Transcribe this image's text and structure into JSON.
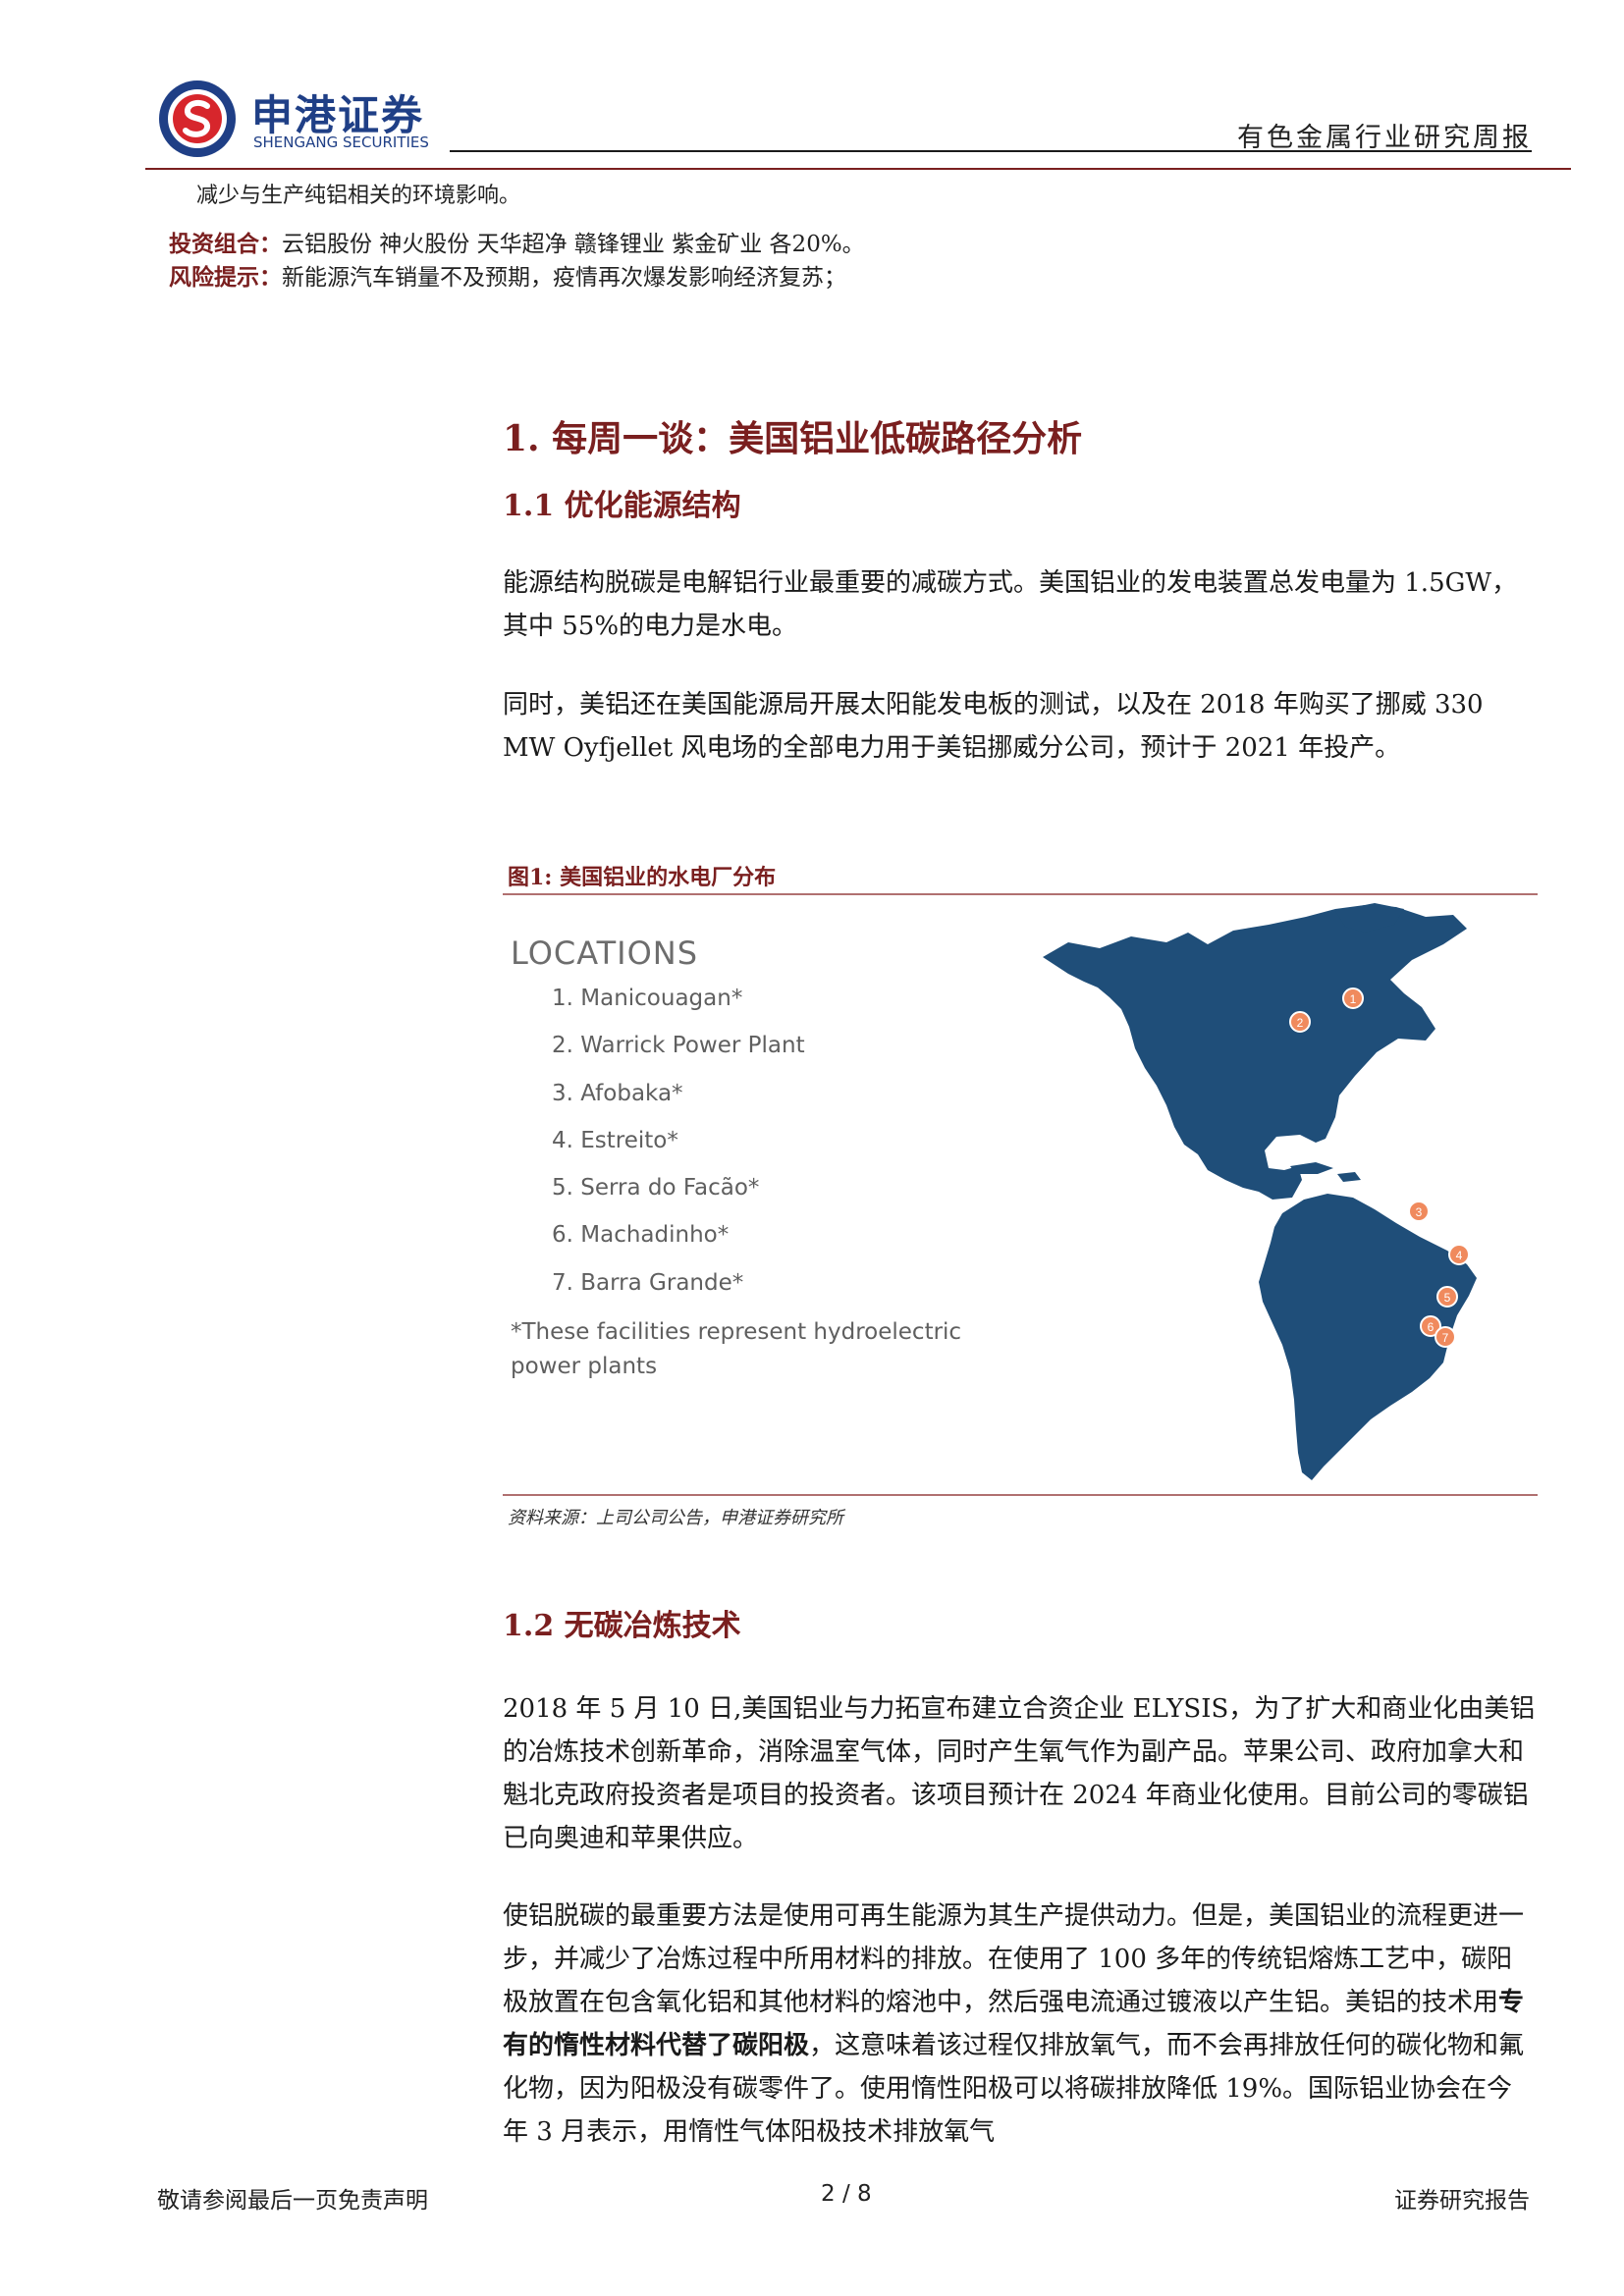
{
  "header": {
    "brand_cn": "申港证券",
    "brand_en": "SHENGANG SECURITIES",
    "report_type": "有色金属行业研究周报",
    "colors": {
      "brand_blue": "#1f3f86",
      "brand_red": "#d7262c",
      "accent": "#7a1f1f"
    }
  },
  "summary": {
    "carry_over": "减少与生产纯铝相关的环境影响。",
    "portfolio_label": "投资组合：",
    "portfolio_text": "云铝股份 神火股份 天华超净 赣锋锂业 紫金矿业 各20%。",
    "risk_label": "风险提示：",
    "risk_text": "新能源汽车销量不及预期，疫情再次爆发影响经济复苏；"
  },
  "section1": {
    "title": "1. 每周一谈：美国铝业低碳路径分析",
    "sub1_title": "1.1 优化能源结构",
    "para1": "能源结构脱碳是电解铝行业最重要的减碳方式。美国铝业的发电装置总发电量为 1.5GW，其中 55%的电力是水电。",
    "para2": "同时，美铝还在美国能源局开展太阳能发电板的测试，以及在 2018 年购买了挪威 330 MW Oyfjellet 风电场的全部电力用于美铝挪威分公司，预计于 2021 年投产。",
    "sub2_title": "1.2 无碳冶炼技术",
    "para3": "2018 年 5 月 10 日,美国铝业与力拓宣布建立合资企业 ELYSIS，为了扩大和商业化由美铝的冶炼技术创新革命，消除温室气体，同时产生氧气作为副产品。苹果公司、政府加拿大和魁北克政府投资者是项目的投资者。该项目预计在 2024 年商业化使用。目前公司的零碳铝已向奥迪和苹果供应。",
    "para4_a": "使铝脱碳的最重要方法是使用可再生能源为其生产提供动力。但是，美国铝业的流程更进一步，并减少了冶炼过程中所用材料的排放。在使用了 100 多年的传统铝熔炼工艺中，碳阳极放置在包含氧化铝和其他材料的熔池中，然后强电流通过镀液以产生铝。美铝的技术用",
    "para4_bold": "专有的惰性材料代替了碳阳极",
    "para4_b": "，这意味着该过程仅排放氧气，而不会再排放任何的碳化物和氟化物，因为阳极没有碳零件了。使用惰性阳极可以将碳排放降低 19%。国际铝业协会在今年 3 月表示，用惰性气体阳极技术排放氧气"
  },
  "figure1": {
    "caption": "图1:  美国铝业的水电厂分布",
    "heading": "LOCATIONS",
    "locations": [
      "1. Manicouagan*",
      "2. Warrick Power Plant",
      "3. Afobaka*",
      "4. Estreito*",
      "5. Serra do Facão*",
      "6. Machadinho*",
      "7. Barra Grande*"
    ],
    "marker_labels": [
      "1",
      "2",
      "3",
      "4",
      "5",
      "6",
      "7"
    ],
    "note": "*These facilities represent hydroelectric power plants",
    "source": "资料来源：上司公司公告，申港证券研究所",
    "colors": {
      "land": "#1f4e79",
      "marker": "#f08a5d"
    }
  },
  "footer": {
    "disclaimer": "敬请参阅最后一页免责声明",
    "page": "2 / 8",
    "doc_type": "证券研究报告"
  }
}
